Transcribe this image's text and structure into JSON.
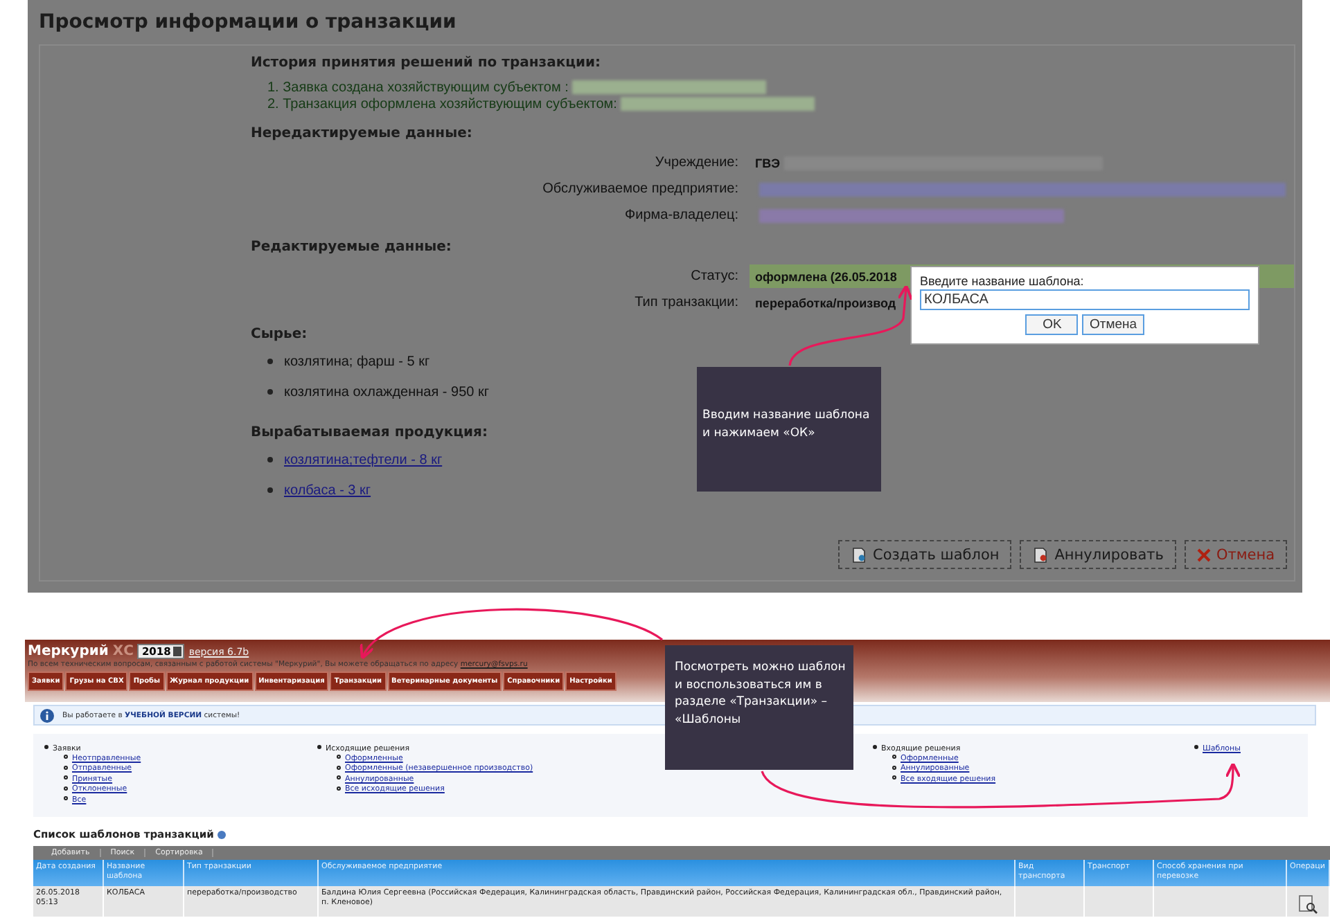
{
  "transaction_view": {
    "title": "Просмотр информации о транзакции",
    "history": {
      "heading": "История принятия решений по транзакции:",
      "items": [
        {
          "number": "1.",
          "text": "Заявка создана хозяйствующим субъектом :",
          "redacted": true
        },
        {
          "number": "2.",
          "text": "Транзакция оформлена хозяйствующим субъектом:",
          "redacted": true
        }
      ]
    },
    "readonly": {
      "heading": "Нередактируемые данные:",
      "fields": [
        {
          "label": "Учреждение:",
          "value": "ГВЭ",
          "redacted": true,
          "highlighted": false
        },
        {
          "label": "Обслуживаемое предприятие:",
          "redacted": true,
          "highlighted": false
        },
        {
          "label": "Фирма-владелец:",
          "redacted": true,
          "highlighted": false
        }
      ]
    },
    "editable": {
      "heading": "Редактируемые данные:",
      "fields": [
        {
          "label": "Статус:",
          "value": "оформлена (26.05.2018",
          "redacted": false,
          "highlighted": true
        },
        {
          "label": "Тип транзакции:",
          "value": "переработка/производ",
          "redacted": false,
          "highlighted": false
        }
      ]
    },
    "raw": {
      "heading": "Сырье:",
      "items": [
        "козлятина; фарш - 5 кг",
        "козлятина охлажденная - 950 кг"
      ]
    },
    "products": {
      "heading": "Вырабатываемая продукция:",
      "items": [
        "козлятина;тефтели - 8 кг",
        "колбаса - 3 кг"
      ]
    },
    "buttons": [
      {
        "kind": "create",
        "label": "Создать шаблон"
      },
      {
        "kind": "annul",
        "label": "Аннулировать"
      },
      {
        "kind": "cancel",
        "label": "Отмена"
      }
    ],
    "template_dialog": {
      "prompt": "Введите название шаблона:",
      "value": "КОЛБАСА",
      "buttons": [
        "OK",
        "Отмена"
      ]
    },
    "callout": "Вводим название шаблона и нажимаем «ОК»"
  },
  "mercury_app": {
    "logo": "Меркурий",
    "logo_suffix": "ХС",
    "year": "2018",
    "version": "версия 6.7b",
    "support_text": "По всем техническим вопросам, связанным с работой системы \"Меркурий\", Вы можете обращаться по адресу",
    "support_email": "mercury@fsvps.ru",
    "tabs": [
      "Заявки",
      "Грузы на СВХ",
      "Пробы",
      "Журнал продукции",
      "Инвентаризация",
      "Транзакции",
      "Ветеринарные документы",
      "Справочники",
      "Настройки"
    ],
    "notice": "Вы работаете в **УЧЕБНОЙ ВЕРСИИ** системы!",
    "menu": [
      {
        "label": "Заявки",
        "children": [
          {
            "label": "Неотправленные"
          },
          {
            "label": "Отправленные"
          },
          {
            "label": "Принятые"
          },
          {
            "label": "Отклоненные"
          },
          {
            "label": "Все"
          }
        ]
      },
      {
        "label": "Исходящие решения",
        "children": [
          {
            "label": "Оформленные"
          },
          {
            "label": "Оформленные (незавершенное производство)"
          },
          {
            "label": "Аннулированные"
          },
          {
            "label": "Все исходящие решения"
          }
        ]
      },
      {
        "label": "Входящие решения",
        "children": [
          {
            "label": "Оформленные"
          },
          {
            "label": "Аннулированные"
          },
          {
            "label": "Все входящие решения"
          }
        ]
      },
      {
        "label": "Шаблоны"
      }
    ],
    "list_title": "Список шаблонов транзакций",
    "toolbar": [
      "Добавить",
      "Поиск",
      "Сортировка"
    ],
    "table": {
      "columns": [
        "Дата создания",
        "Название шаблона",
        "Тип транзакции",
        "Обслуживаемое предприятие",
        "Вид транспорта",
        "Транспорт",
        "Способ хранения при перевозке",
        "Операци"
      ],
      "rows": [
        {
          "cells": [
            "26.05.2018 05:13",
            "КОЛБАСА",
            "переработка/производство",
            "Балдина Юлия Сергеевна (Российская Федерация, Калининградская область, Правдинский район, Российская Федерация, Калининградская обл., Правдинский район, п. Кленовое)",
            "",
            "",
            ""
          ]
        }
      ]
    },
    "callout": "Посмотреть можно шаблон и воспользоваться им в разделе «Транзакции» – «Шаблоны"
  }
}
